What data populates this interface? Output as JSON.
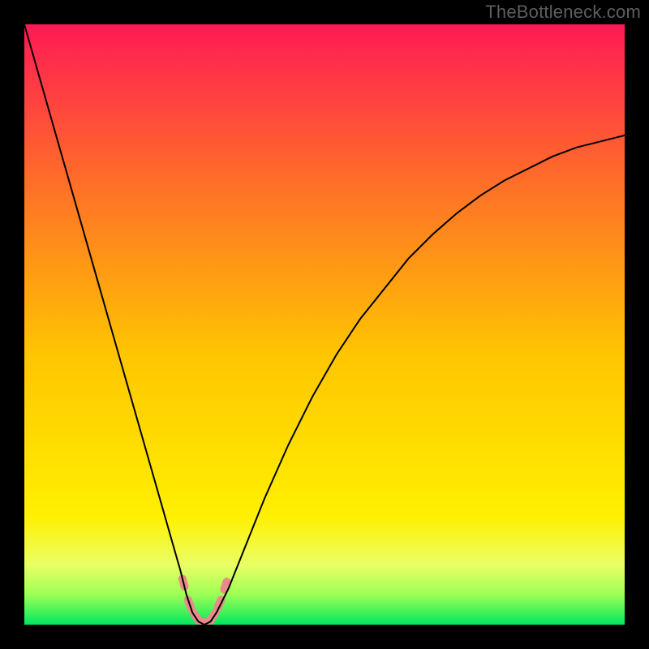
{
  "watermark": "TheBottleneck.com",
  "chart_data": {
    "type": "line",
    "title": "",
    "xlabel": "",
    "ylabel": "",
    "xlim": [
      0,
      100
    ],
    "ylim": [
      0,
      100
    ],
    "grid": false,
    "legend": false,
    "background_gradient": {
      "top": "#ff1a55",
      "mid": "#ffd200",
      "green_band_top": "#eaff66",
      "green_band_bottom": "#00e85e"
    },
    "series": [
      {
        "name": "bottleneck-curve",
        "color": "#000000",
        "x": [
          0,
          2,
          4,
          6,
          8,
          10,
          12,
          14,
          16,
          18,
          20,
          22,
          24,
          26,
          27,
          28,
          29,
          30,
          31,
          32,
          34,
          36,
          40,
          44,
          48,
          52,
          56,
          60,
          64,
          68,
          72,
          76,
          80,
          84,
          88,
          92,
          96,
          100
        ],
        "y": [
          100,
          93,
          86,
          79,
          72,
          65,
          58,
          51,
          44,
          37,
          30,
          23,
          16,
          9,
          5,
          2,
          0.5,
          0,
          0.5,
          2,
          6,
          11,
          21,
          30,
          38,
          45,
          51,
          56,
          61,
          65,
          68.5,
          71.5,
          74,
          76,
          78,
          79.5,
          80.5,
          81.5
        ]
      }
    ],
    "markers": {
      "name": "sweet-spot-band",
      "color": "#e98b8b",
      "points": [
        {
          "x": 26.5,
          "y": 7
        },
        {
          "x": 27.5,
          "y": 3.5
        },
        {
          "x": 28.5,
          "y": 1.5
        },
        {
          "x": 29.5,
          "y": 0.5
        },
        {
          "x": 30.5,
          "y": 0.5
        },
        {
          "x": 31.5,
          "y": 1.5
        },
        {
          "x": 32.5,
          "y": 3.5
        },
        {
          "x": 33.5,
          "y": 6.5
        }
      ]
    }
  }
}
